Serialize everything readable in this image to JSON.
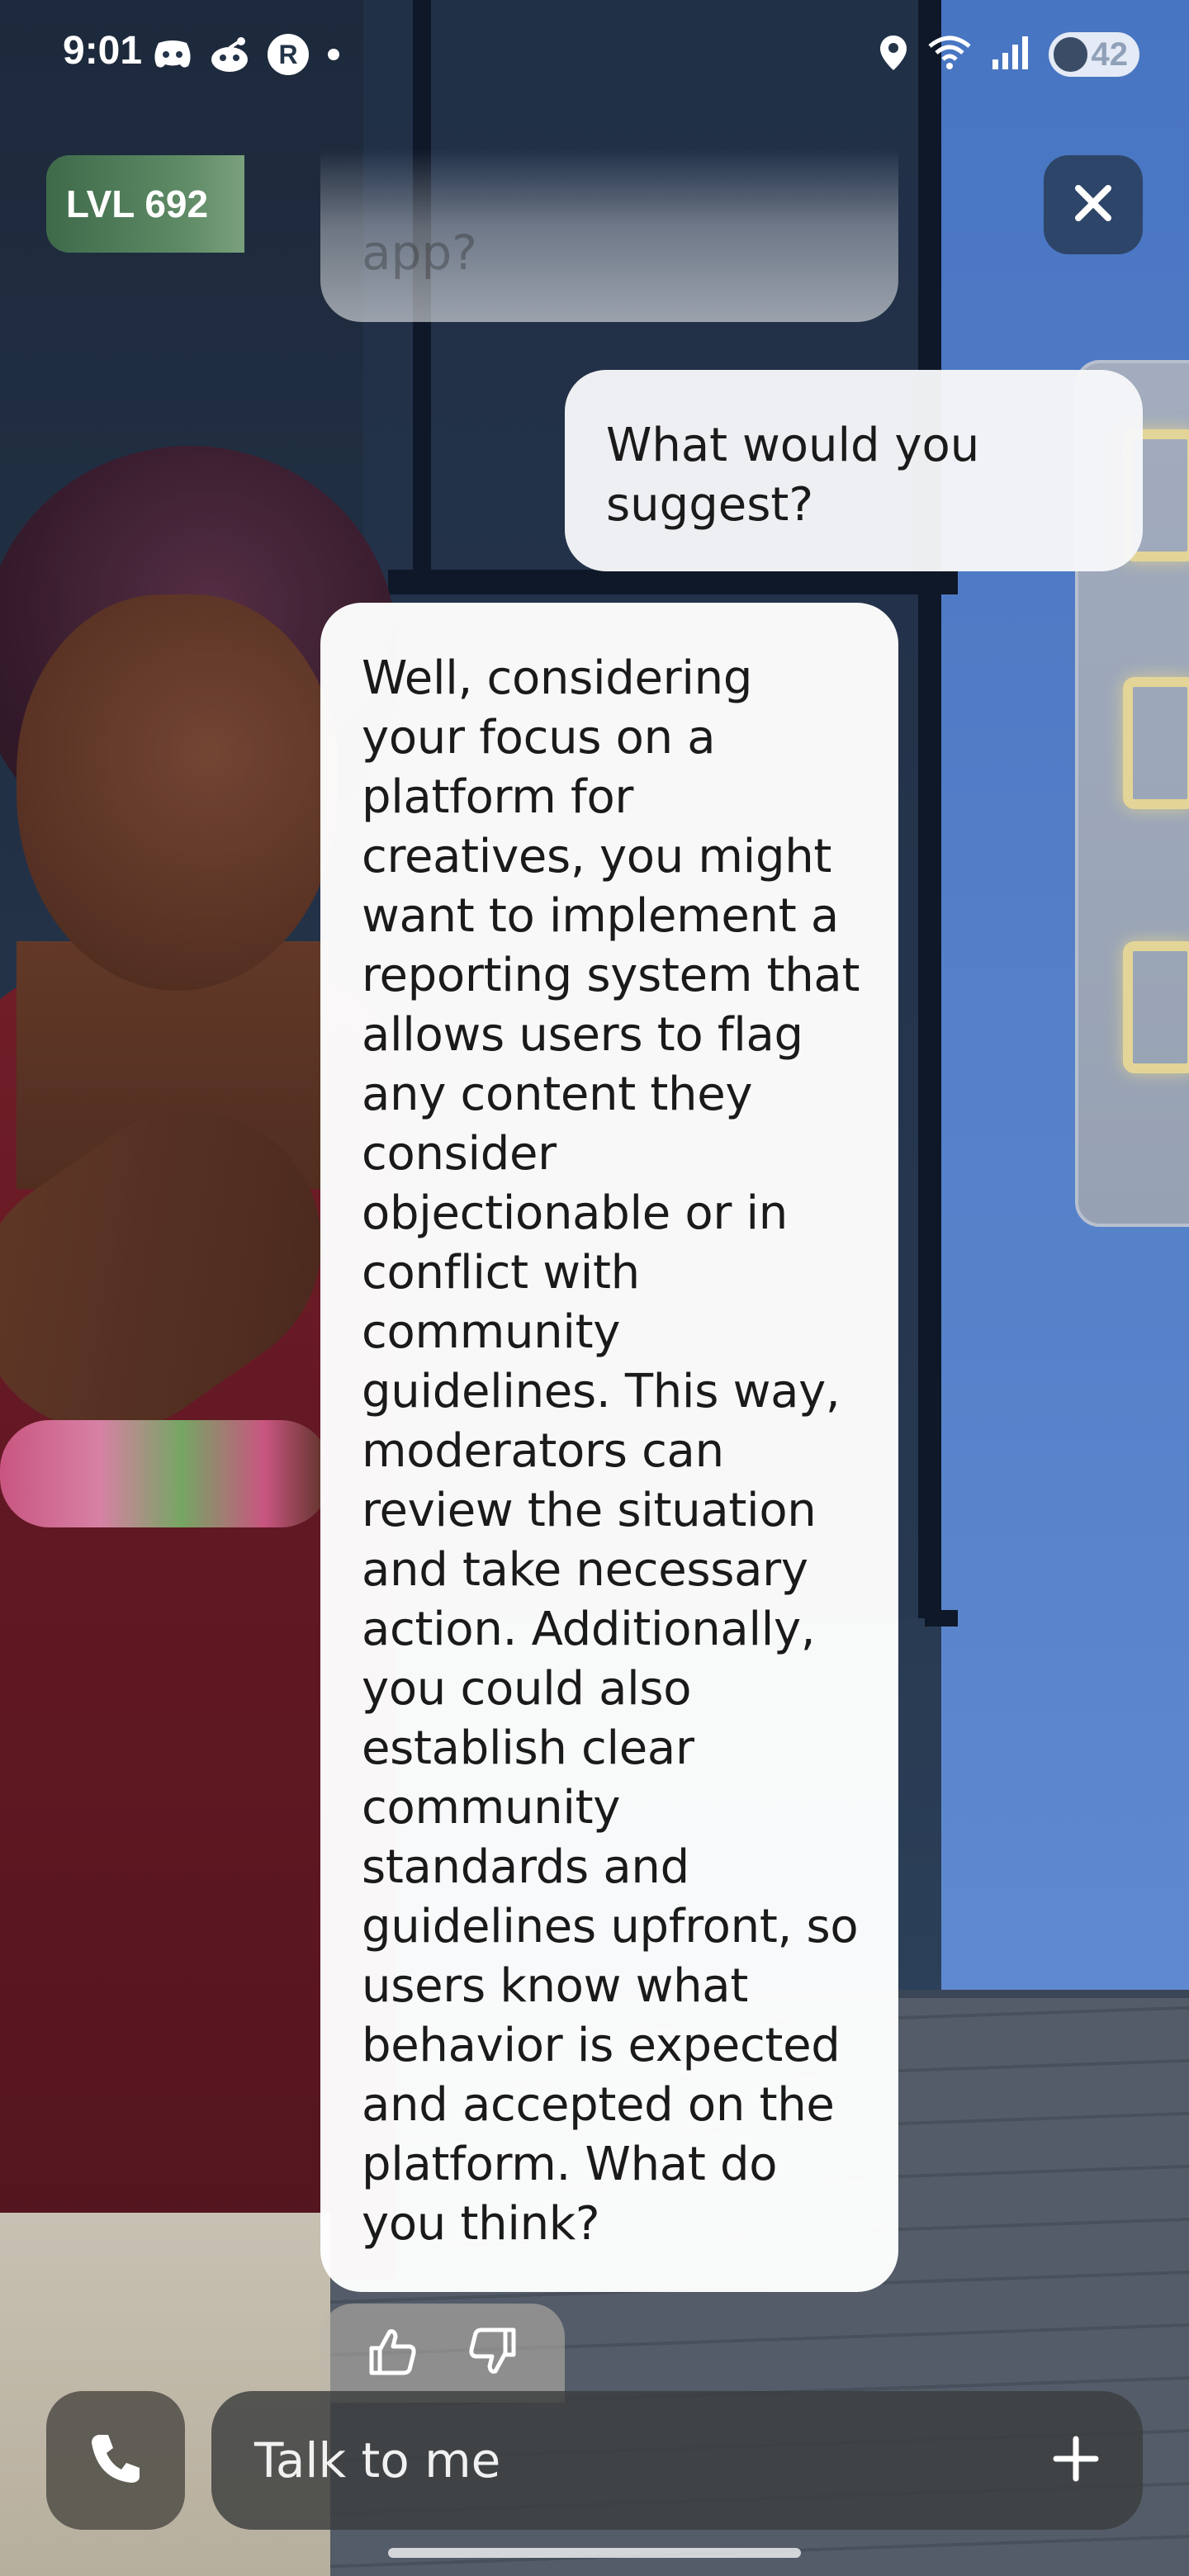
{
  "status_bar": {
    "time": "9:01",
    "left_icons": [
      "discord-icon",
      "reddit-icon",
      "r-app-icon",
      "dot-icon"
    ],
    "right_icons": [
      "location-icon",
      "wifi-icon",
      "signal-icon"
    ],
    "battery_level": "42",
    "battery_fraction": 0.42
  },
  "header": {
    "level_label": "LVL 692",
    "close_icon": "close-icon"
  },
  "chat": {
    "previous_message_partial": "app?",
    "user_message": "What would you suggest?",
    "ai_message": "Well, considering your focus on a platform for creatives, you might want to implement a reporting system that allows users to flag any content they consider objectionable or in conflict with community guidelines. This way, moderators can review the situation and take necessary action. Additionally, you could also establish clear community standards and guidelines upfront, so users know what behavior is expected and accepted on the platform. What do you think?",
    "feedback_icons": [
      "thumbs-up-icon",
      "thumbs-down-icon"
    ]
  },
  "input": {
    "placeholder": "Talk to me",
    "call_icon": "phone-icon",
    "plus_icon": "plus-icon"
  },
  "colors": {
    "level_badge": "#5f8b66",
    "close_button": "#2d4568",
    "bubble": "#ffffff",
    "input_bar": "#3c3e3e"
  }
}
